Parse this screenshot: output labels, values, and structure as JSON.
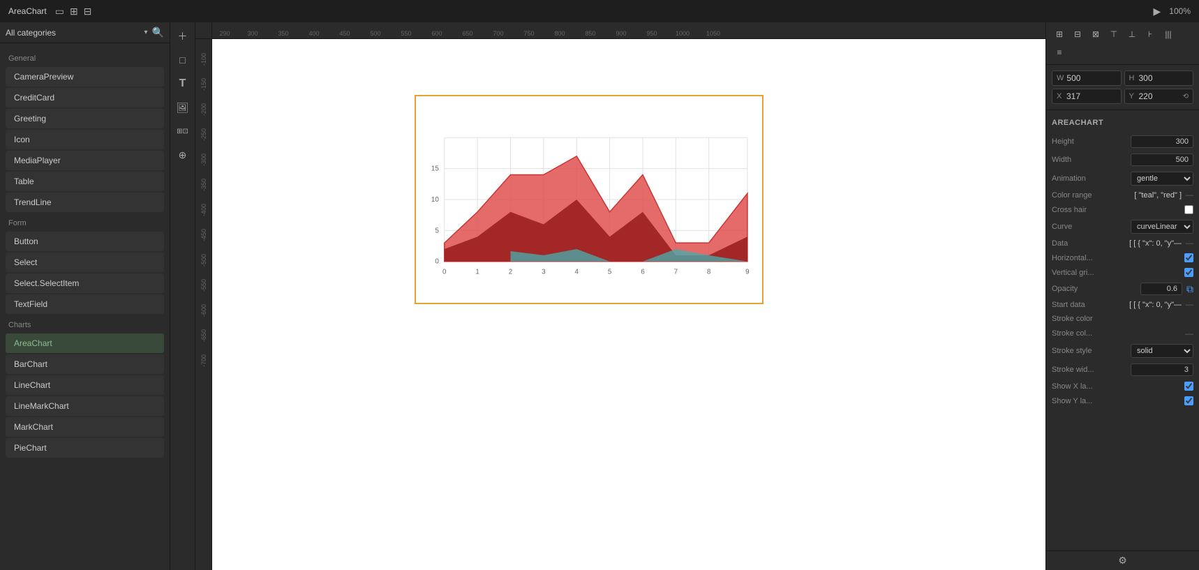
{
  "titlebar": {
    "title": "AreaChart",
    "zoom": "100%",
    "icons": [
      "rectangle-icon",
      "resize-icon",
      "layout-icon"
    ]
  },
  "sidebar": {
    "category": "All categories",
    "search_placeholder": "Search",
    "sections": [
      {
        "label": "General",
        "items": [
          "CameraPreview",
          "CreditCard",
          "Greeting",
          "Icon",
          "MediaPlayer",
          "Table",
          "TrendLine"
        ]
      },
      {
        "label": "Form",
        "items": [
          "Button",
          "Select",
          "Select.SelectItem",
          "TextField"
        ]
      },
      {
        "label": "Charts",
        "items": [
          "AreaChart",
          "BarChart",
          "LineChart",
          "LineMarkChart",
          "MarkChart",
          "PieChart"
        ]
      }
    ]
  },
  "ruler": {
    "top_marks": [
      "",
      "300",
      "350",
      "400",
      "450",
      "500",
      "550",
      "600",
      "650",
      "700",
      "750",
      "800",
      "850",
      "900",
      "950",
      "1000",
      "1050"
    ],
    "left_marks": [
      "-100",
      "-150",
      "-200",
      "-250",
      "-300",
      "-350",
      "-400",
      "-450",
      "-500",
      "-550",
      "-600",
      "-650",
      "-700"
    ]
  },
  "chart": {
    "x_labels": [
      "0",
      "1",
      "2",
      "3",
      "4",
      "5",
      "6",
      "7",
      "8",
      "9"
    ],
    "y_labels": [
      "0",
      "5",
      "10",
      "15"
    ]
  },
  "properties": {
    "section": "AREACHART",
    "fields": {
      "height_label": "Height",
      "height_value": "300",
      "width_label": "Width",
      "width_value": "500",
      "animation_label": "Animation",
      "animation_value": "gentle",
      "color_range_label": "Color range",
      "color_range_value": "[ \"teal\", \"red\" ]",
      "crosshair_label": "Cross hair",
      "curve_label": "Curve",
      "curve_value": "curveLinear",
      "data_label": "Data",
      "data_value": "[ [ { \"x\": 0, \"y\"—",
      "horizontal_label": "Horizontal...",
      "vertical_label": "Vertical gri...",
      "opacity_label": "Opacity",
      "opacity_value": "0.6",
      "start_data_label": "Start data",
      "start_data_value": "[ [ { \"x\": 0, \"y\"—",
      "stroke_color_label": "Stroke color",
      "stroke_col_label": "Stroke col...",
      "stroke_style_label": "Stroke style",
      "stroke_style_value": "solid",
      "stroke_width_label": "Stroke wid...",
      "stroke_width_value": "3",
      "show_x_label": "Show X la...",
      "show_y_label": "Show Y la..."
    }
  },
  "dimensions": {
    "w_label": "W",
    "w_value": "500",
    "h_label": "H",
    "h_value": "300",
    "x_label": "X",
    "x_value": "317",
    "y_label": "Y",
    "y_value": "220"
  }
}
